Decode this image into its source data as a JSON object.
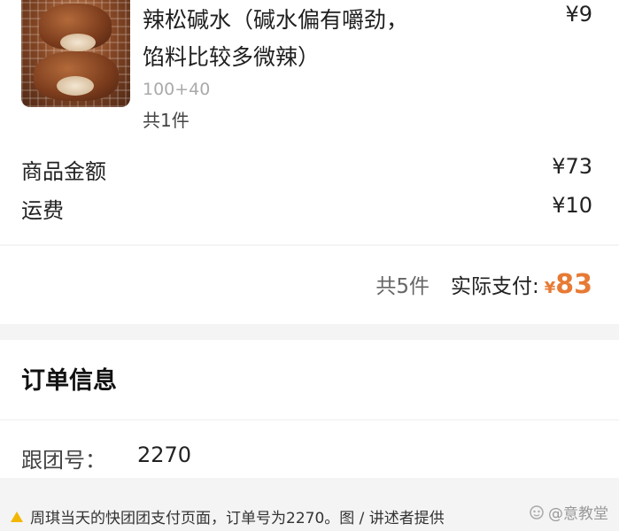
{
  "product": {
    "title": "辣松碱水（碱水偏有嚼劲，馅料比较多微辣）",
    "price": "¥9",
    "spec": "100+40",
    "count": "共1件"
  },
  "totals": {
    "subtotal_label": "商品金额",
    "subtotal_value": "¥73",
    "shipping_label": "运费",
    "shipping_value": "¥10"
  },
  "summary": {
    "item_count": "共5件",
    "paid_label": "实际支付:",
    "currency": "¥",
    "paid_amount": "83",
    "accent_color": "#e77a35"
  },
  "order_info": {
    "title": "订单信息",
    "group_label": "跟团号：",
    "group_value": "2270"
  },
  "caption": {
    "text": "周琪当天的快团团支付页面，订单号为2270。图 / 讲述者提供",
    "watermark": "@意教堂",
    "icon": "warning-triangle-icon"
  }
}
